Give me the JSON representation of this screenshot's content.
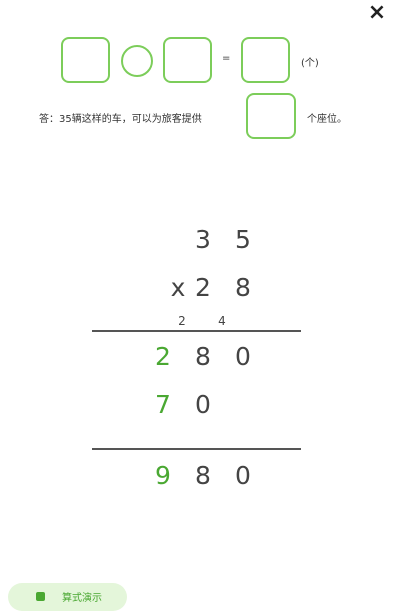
{
  "close": {
    "icon": "×"
  },
  "equation": {
    "equals": "=",
    "unit": "(个)"
  },
  "answer": {
    "prefix": "答：35辆这样的车，可以为旅客提供",
    "suffix": "个座位。"
  },
  "multiplication": {
    "multiplicand": [
      "3",
      "5"
    ],
    "operator": "x",
    "multiplier": [
      "2",
      "8"
    ],
    "carries": [
      "2",
      "4"
    ],
    "partial1": [
      "2",
      "8",
      "0"
    ],
    "partial2": [
      "7",
      "0"
    ],
    "result": [
      "9",
      "8",
      "0"
    ]
  },
  "demo_button": {
    "label": "算式演示"
  },
  "colors": {
    "accent": "#4aa832",
    "box_border": "#7ccd5a",
    "button_bg": "#e4f6da"
  }
}
